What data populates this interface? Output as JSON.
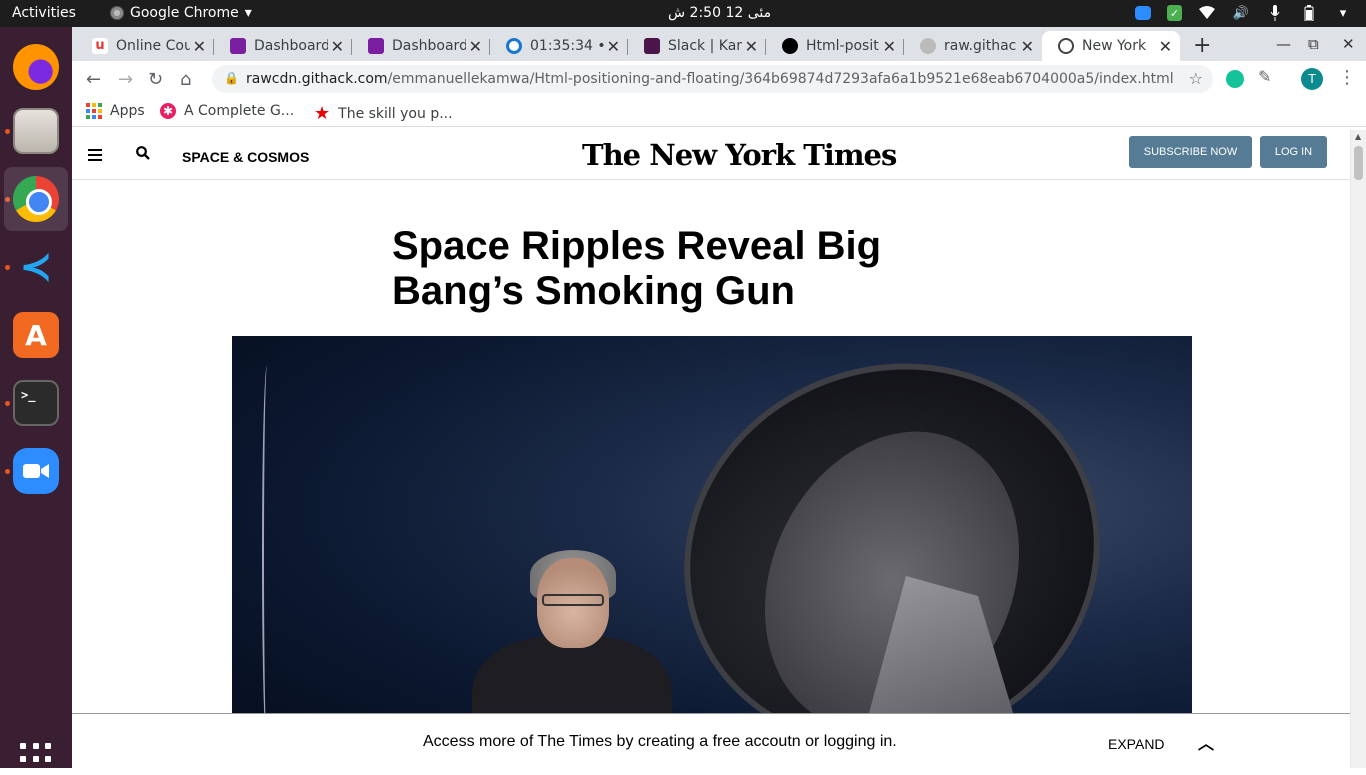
{
  "system": {
    "activities": "Activities",
    "app_menu": "Google Chrome",
    "clock": "مئى 12  2:50 ش"
  },
  "tabs": [
    {
      "title": "Online Cou",
      "favicon_color": "#e53935"
    },
    {
      "title": "Dashboard",
      "favicon_color": "#7b1fa2"
    },
    {
      "title": "Dashboard",
      "favicon_color": "#7b1fa2"
    },
    {
      "title": "01:35:34 • C",
      "favicon_color": "#1976d2"
    },
    {
      "title": "Slack | Kam",
      "favicon_color": "#4a154b"
    },
    {
      "title": "Html-posit",
      "favicon_color": "#000000"
    },
    {
      "title": "raw.githac",
      "favicon_color": "#888888"
    },
    {
      "title": "New York",
      "favicon_color": "#444444",
      "active": true
    }
  ],
  "toolbar": {
    "url_host": "rawcdn.githack.com",
    "url_path": "/emmanuellekamwa/Html-positioning-and-floating/364b69874d7293afa6a1b9521e68eab6704000a5/index.html",
    "avatar_letter": "T"
  },
  "bookmarks": [
    {
      "label": "Apps",
      "icon": "apps-grid-icon"
    },
    {
      "label": "A Complete G...",
      "icon": "asterisk-icon"
    },
    {
      "label": "The skill you p...",
      "icon": "star-icon"
    }
  ],
  "page": {
    "section": "SPACE & COSMOS",
    "logo": "The New York Times",
    "subscribe": "SUBSCRIBE NOW",
    "login": "LOG IN",
    "headline": "Space Ripples Reveal Big Bang’s Smoking Gun",
    "bottom_message": "Access more of The Times by creating a free accoutn or logging in.",
    "expand": "EXPAND"
  },
  "colors": {
    "button": "#567b95",
    "dock": "#3a1f33",
    "topbar": "#1d1d1d"
  }
}
